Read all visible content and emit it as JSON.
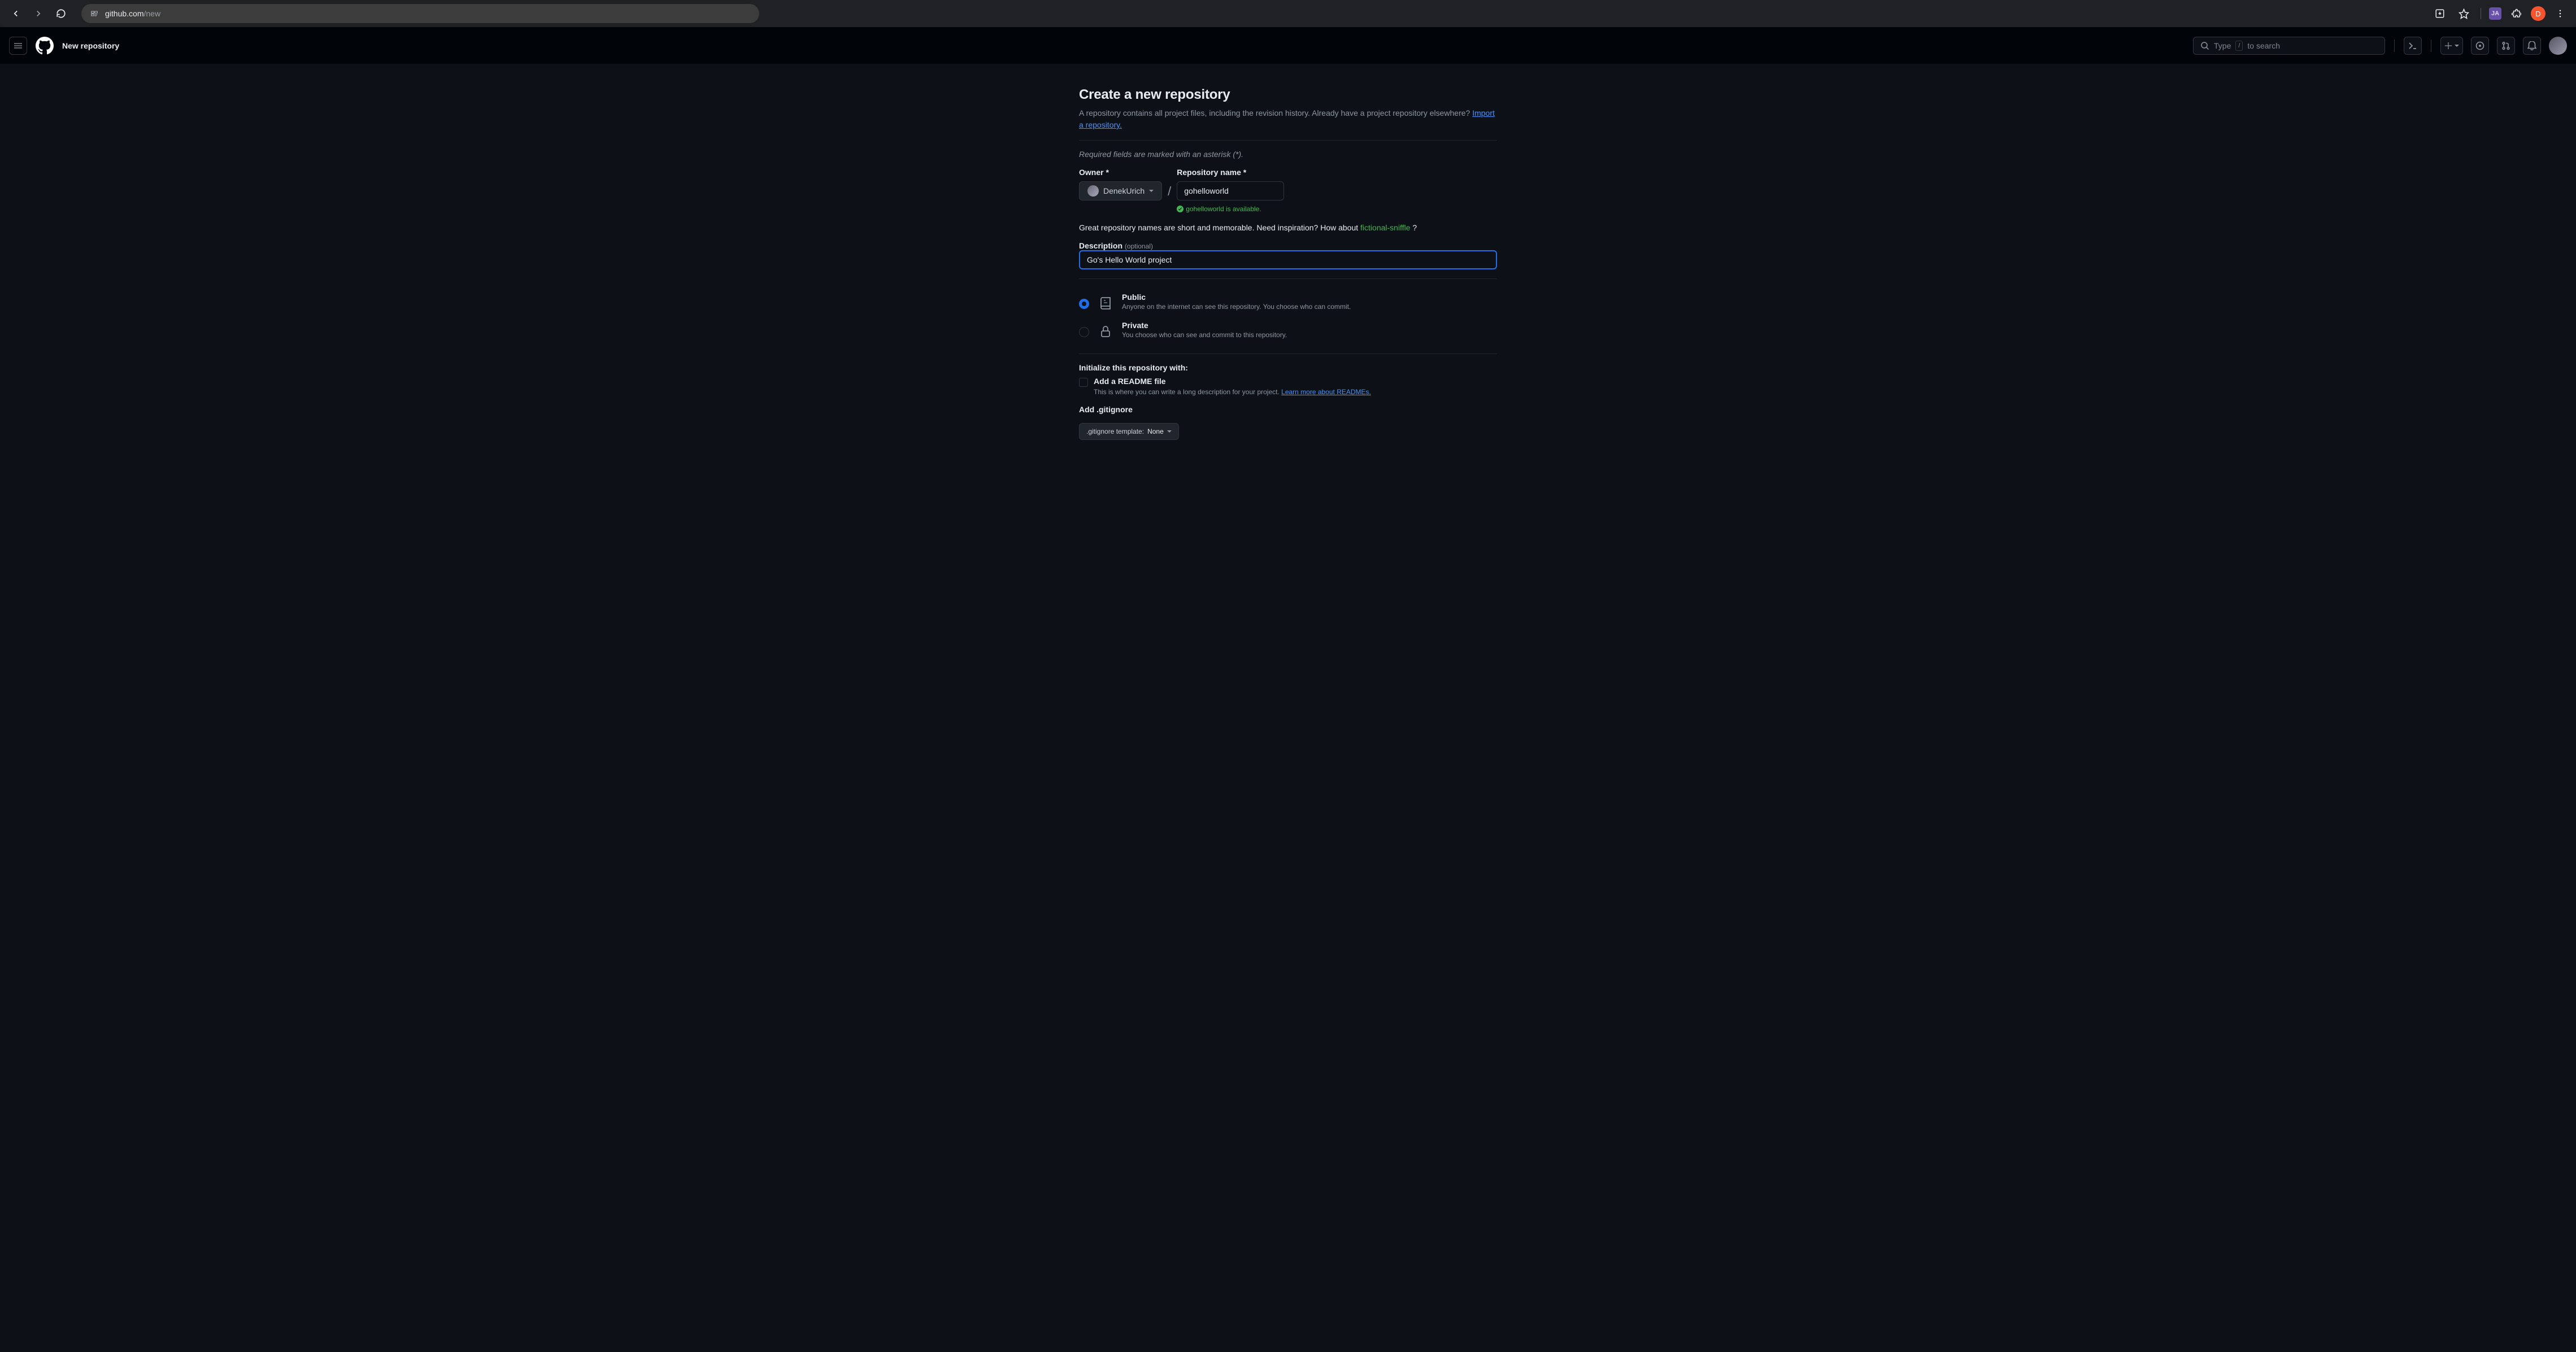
{
  "browser": {
    "url_host": "github.com",
    "url_path": "/new",
    "avatar_letter": "D",
    "ext_label": "JA"
  },
  "header": {
    "context": "New repository",
    "search_placeholder_pre": "Type",
    "search_key": "/",
    "search_placeholder_post": "to search"
  },
  "page": {
    "title": "Create a new repository",
    "intro_pre": "A repository contains all project files, including the revision history. Already have a project repository elsewhere? ",
    "import_link": "Import a repository.",
    "required_note": "Required fields are marked with an asterisk (*).",
    "owner_label": "Owner *",
    "owner_value": "DenekUrich",
    "repo_label": "Repository name *",
    "repo_value": "gohelloworld",
    "available_msg": "gohelloworld is available.",
    "inspire_pre": "Great repository names are short and memorable. Need inspiration? How about ",
    "suggestion": "fictional-sniffle",
    "inspire_post": " ?",
    "desc_label": "Description",
    "desc_optional": "(optional)",
    "desc_value": "Go's Hello World project",
    "visibility": {
      "public": {
        "title": "Public",
        "desc": "Anyone on the internet can see this repository. You choose who can commit."
      },
      "private": {
        "title": "Private",
        "desc": "You choose who can see and commit to this repository."
      }
    },
    "init_heading": "Initialize this repository with:",
    "readme": {
      "title": "Add a README file",
      "desc_pre": "This is where you can write a long description for your project. ",
      "link": "Learn more about READMEs."
    },
    "gitignore": {
      "title": "Add .gitignore",
      "template_label": ".gitignore template:",
      "value": "None"
    }
  }
}
